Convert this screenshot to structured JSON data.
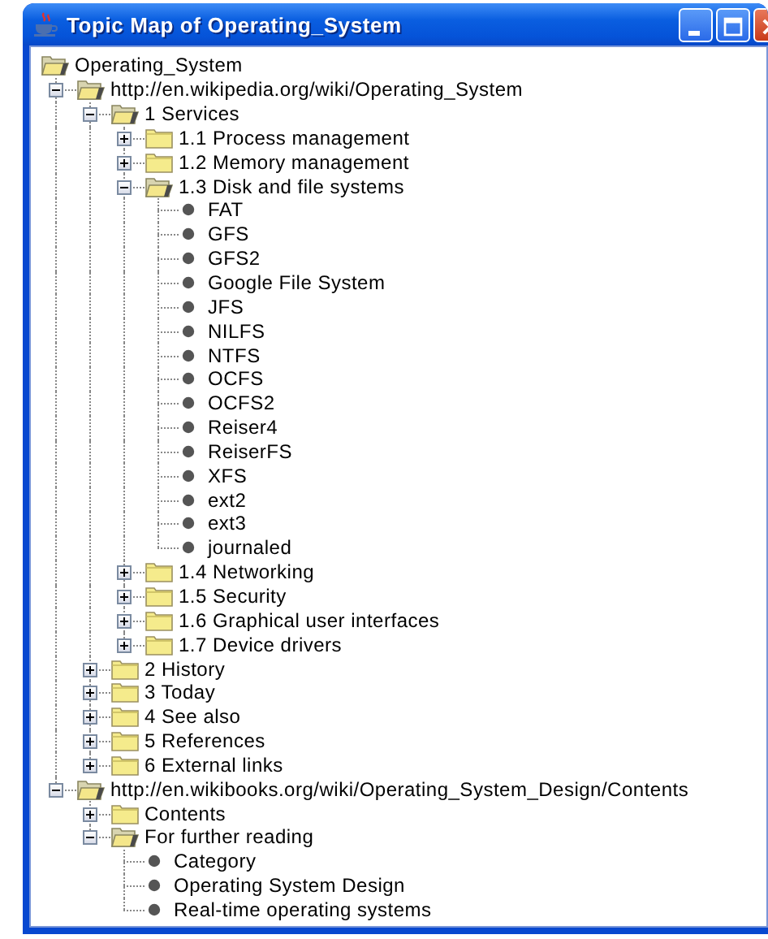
{
  "window": {
    "title": "Topic Map of Operating_System"
  },
  "tree": [
    {
      "label": "Operating_System",
      "kind": "folder",
      "expanded": true,
      "children": [
        {
          "label": "http://en.wikipedia.org/wiki/Operating_System",
          "kind": "folder",
          "expanded": true,
          "children": [
            {
              "label": "1 Services",
              "kind": "folder",
              "expanded": true,
              "children": [
                {
                  "label": "1.1 Process management",
                  "kind": "folder",
                  "expanded": false
                },
                {
                  "label": "1.2 Memory management",
                  "kind": "folder",
                  "expanded": false
                },
                {
                  "label": "1.3 Disk and file systems",
                  "kind": "folder",
                  "expanded": true,
                  "children": [
                    {
                      "label": "FAT",
                      "kind": "leaf"
                    },
                    {
                      "label": "GFS",
                      "kind": "leaf"
                    },
                    {
                      "label": "GFS2",
                      "kind": "leaf"
                    },
                    {
                      "label": "Google File System",
                      "kind": "leaf"
                    },
                    {
                      "label": "JFS",
                      "kind": "leaf"
                    },
                    {
                      "label": "NILFS",
                      "kind": "leaf"
                    },
                    {
                      "label": "NTFS",
                      "kind": "leaf"
                    },
                    {
                      "label": "OCFS",
                      "kind": "leaf"
                    },
                    {
                      "label": "OCFS2",
                      "kind": "leaf"
                    },
                    {
                      "label": "Reiser4",
                      "kind": "leaf"
                    },
                    {
                      "label": "ReiserFS",
                      "kind": "leaf"
                    },
                    {
                      "label": "XFS",
                      "kind": "leaf"
                    },
                    {
                      "label": "ext2",
                      "kind": "leaf"
                    },
                    {
                      "label": "ext3",
                      "kind": "leaf"
                    },
                    {
                      "label": "journaled",
                      "kind": "leaf"
                    }
                  ]
                },
                {
                  "label": "1.4 Networking",
                  "kind": "folder",
                  "expanded": false
                },
                {
                  "label": "1.5 Security",
                  "kind": "folder",
                  "expanded": false
                },
                {
                  "label": "1.6 Graphical user interfaces",
                  "kind": "folder",
                  "expanded": false
                },
                {
                  "label": "1.7 Device drivers",
                  "kind": "folder",
                  "expanded": false
                }
              ]
            },
            {
              "label": "2 History",
              "kind": "folder",
              "expanded": false
            },
            {
              "label": "3 Today",
              "kind": "folder",
              "expanded": false
            },
            {
              "label": "4 See also",
              "kind": "folder",
              "expanded": false
            },
            {
              "label": "5 References",
              "kind": "folder",
              "expanded": false
            },
            {
              "label": "6 External links",
              "kind": "folder",
              "expanded": false
            }
          ]
        },
        {
          "label": "http://en.wikibooks.org/wiki/Operating_System_Design/Contents",
          "kind": "folder",
          "expanded": true,
          "children": [
            {
              "label": "Contents",
              "kind": "folder",
              "expanded": false
            },
            {
              "label": "For further reading",
              "kind": "folder",
              "expanded": true,
              "children": [
                {
                  "label": "Category",
                  "kind": "leaf"
                },
                {
                  "label": "Operating System Design",
                  "kind": "leaf"
                },
                {
                  "label": "Real-time operating systems",
                  "kind": "leaf"
                }
              ]
            }
          ]
        }
      ]
    }
  ]
}
